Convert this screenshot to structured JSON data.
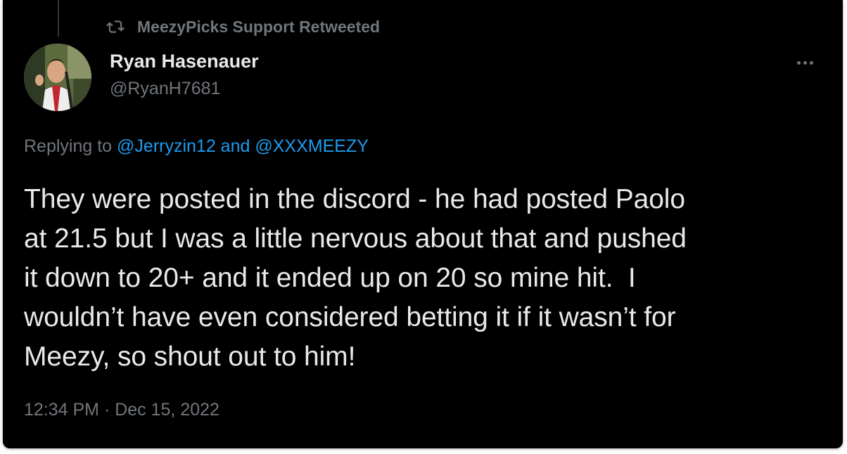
{
  "retweet": {
    "icon": "retweet-icon",
    "label": "MeezyPicks Support Retweeted"
  },
  "author": {
    "name": "Ryan Hasenauer",
    "handle": "@RyanH7681"
  },
  "menu": {
    "icon": "more-options-icon"
  },
  "reply": {
    "prefix": "Replying to ",
    "mention1": "@Jerryzin12",
    "conj": " and ",
    "mention2": "@XXXMEEZY"
  },
  "tweet": {
    "lines": [
      "They were posted in the discord - he had posted Paolo",
      "at 21.5 but I was a little nervous about that and pushed",
      "it down to 20+ and it ended up on 20 so mine hit.  I",
      "wouldn’t have even considered betting it if it wasn’t for",
      "Meezy, so shout out to him!"
    ]
  },
  "meta": {
    "timestamp": "12:34 PM · Dec 15, 2022"
  },
  "colors": {
    "background": "#000000",
    "text": "#e7e9ea",
    "muted": "#71767b",
    "link": "#1d9bf0"
  }
}
